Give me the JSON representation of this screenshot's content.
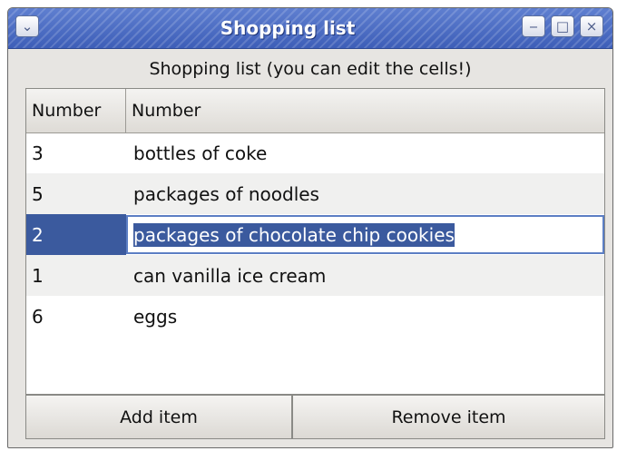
{
  "window": {
    "title": "Shopping list",
    "menu_icon": "⌄",
    "minimize_icon": "‒",
    "maximize_icon": "□",
    "close_icon": "×"
  },
  "heading": "Shopping list (you can edit the cells!)",
  "table": {
    "columns": [
      "Number",
      "Number"
    ],
    "rows": [
      {
        "number": "3",
        "item": "bottles of coke"
      },
      {
        "number": "5",
        "item": "packages of noodles"
      },
      {
        "number": "2",
        "item": "packages of chocolate chip cookies"
      },
      {
        "number": "1",
        "item": "can vanilla ice cream"
      },
      {
        "number": "6",
        "item": "eggs"
      }
    ],
    "selected_row": 2
  },
  "buttons": {
    "add": "Add item",
    "remove": "Remove item"
  },
  "colors": {
    "titlebar": "#4a6bc4",
    "selection": "#3b5a9e"
  }
}
